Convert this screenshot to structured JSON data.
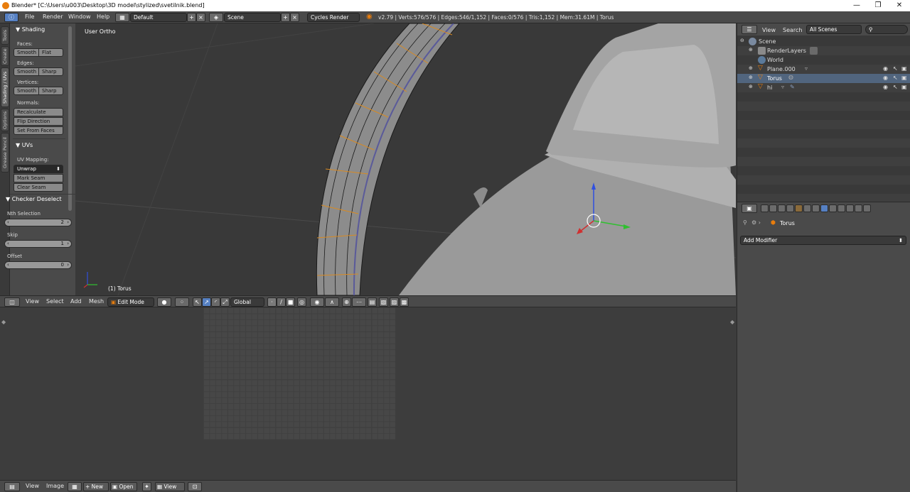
{
  "window": {
    "title": "Blender* [C:\\Users\\u003\\Desktop\\3D model\\stylized\\svetilnik.blend]",
    "minimize": "—",
    "maximize": "❐",
    "close": "✕"
  },
  "topbar": {
    "menus": [
      "File",
      "Render",
      "Window",
      "Help"
    ],
    "screen_layout": "Default",
    "scene": "Scene",
    "render_engine": "Cycles Render",
    "stats": "v2.79 | Verts:576/576 | Edges:546/1,152 | Faces:0/576 | Tris:1,152 | Mem:31.61M | Torus"
  },
  "left_tabs": [
    "Tools",
    "Create",
    "Shading / UVs",
    "Options",
    "Grease Pencil"
  ],
  "toolshelf": {
    "shading_title": "Shading",
    "faces_label": "Faces:",
    "faces_buttons": [
      "Smooth",
      "Flat"
    ],
    "edges_label": "Edges:",
    "edges_buttons": [
      "Smooth",
      "Sharp"
    ],
    "vertices_label": "Vertices:",
    "vertices_buttons": [
      "Smooth",
      "Sharp"
    ],
    "normals_label": "Normals:",
    "normals_buttons": [
      "Recalculate",
      "Flip Direction",
      "Set From Faces"
    ],
    "uvs_title": "UVs",
    "uv_mapping_label": "UV Mapping:",
    "uv_buttons": [
      "Unwrap",
      "Mark Seam",
      "Clear Seam"
    ],
    "checker_title": "Checker Deselect",
    "nth_label": "Nth Selection",
    "nth_value": "2",
    "skip_label": "Skip",
    "skip_value": "1",
    "offset_label": "Offset",
    "offset_value": "0"
  },
  "viewport": {
    "view_label": "User Ortho",
    "object_label": "(1) Torus"
  },
  "viewport_header": {
    "menus": [
      "View",
      "Select",
      "Add",
      "Mesh"
    ],
    "mode": "Edit Mode",
    "orientation": "Global"
  },
  "uv_header": {
    "menus": [
      "View",
      "Image"
    ],
    "new_label": "New",
    "open_label": "Open",
    "view_label": "View"
  },
  "outliner": {
    "menus": [
      "View",
      "Search"
    ],
    "filter": "All Scenes",
    "items": [
      {
        "name": "Scene",
        "indent": 0,
        "icon": "scene-icon"
      },
      {
        "name": "RenderLayers",
        "indent": 1,
        "icon": "renderlayers-icon"
      },
      {
        "name": "World",
        "indent": 1,
        "icon": "world-icon"
      },
      {
        "name": "Plane.000",
        "indent": 1,
        "icon": "mesh-object-icon"
      },
      {
        "name": "Torus",
        "indent": 1,
        "icon": "mesh-object-icon"
      },
      {
        "name": "hi",
        "indent": 1,
        "icon": "mesh-object-icon"
      }
    ]
  },
  "properties": {
    "object_name": "Torus",
    "add_modifier": "Add Modifier"
  },
  "colors": {
    "accent_blue": "#5680c2",
    "orange": "#e87d0d",
    "panel_bg": "#4a4a4a"
  }
}
